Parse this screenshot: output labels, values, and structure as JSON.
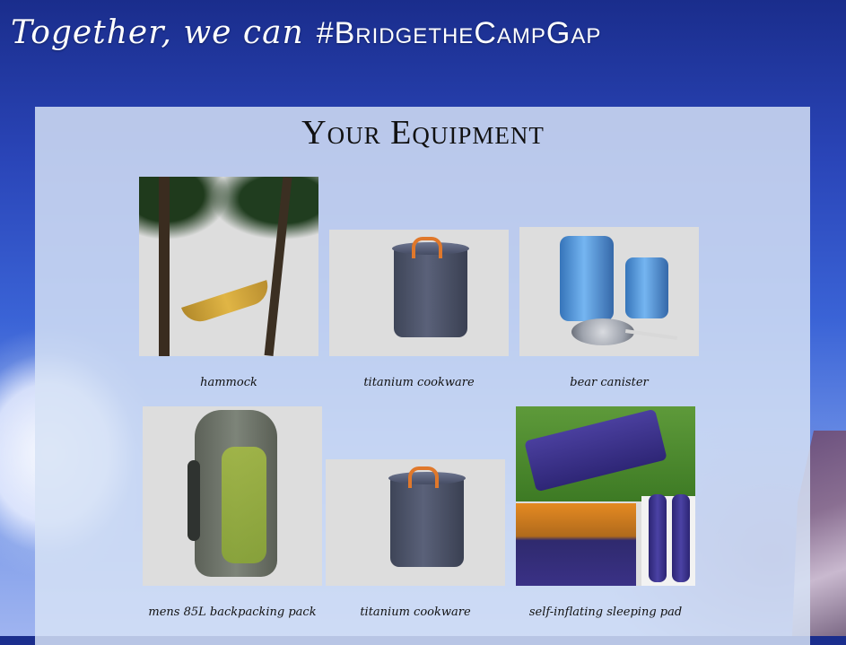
{
  "header": {
    "tagline": "Together, we can",
    "hashtag": "#BridgetheCampGap"
  },
  "panel": {
    "title": "Your Equipment"
  },
  "items": [
    {
      "caption": "hammock",
      "icon": "hammock-photo"
    },
    {
      "caption": "titanium cookware",
      "icon": "cookware-photo"
    },
    {
      "caption": "bear canister",
      "icon": "bear-canister-photo"
    },
    {
      "caption": "mens 85L backpacking pack",
      "icon": "backpack-photo"
    },
    {
      "caption": "titanium cookware",
      "icon": "cookware-photo"
    },
    {
      "caption": "self-inflating sleeping pad",
      "icon": "sleeping-pad-photo"
    }
  ]
}
